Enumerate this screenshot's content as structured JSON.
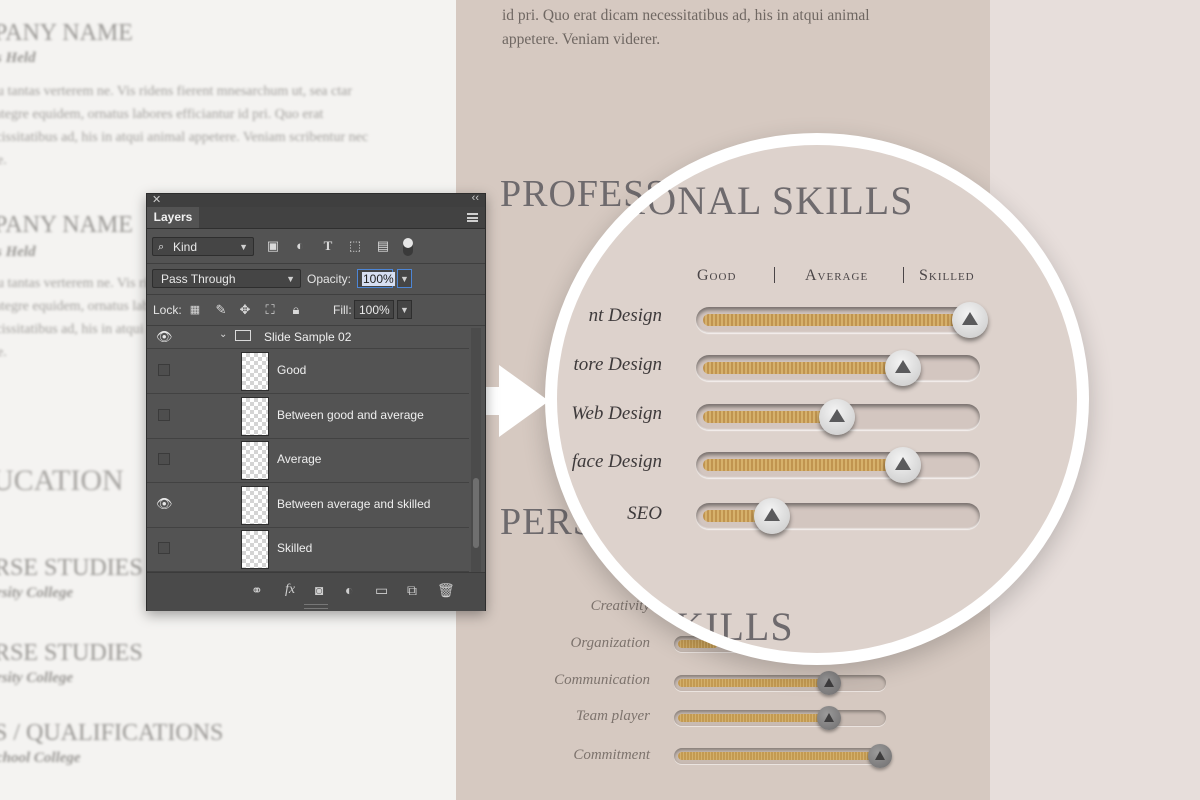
{
  "resume_left": {
    "jobs": [
      {
        "title": "PANY NAME",
        "subtitle": "s Held",
        "text": "bu tantas verterem ne. Vis ridens fierent mnesarchum ut, sea ctar integre equidem, ornatus labores efficiantur id pri. Quo erat scissitatibus ad, his in atqui animal appetere. Veniam scribentur nec ne."
      },
      {
        "title": "PANY NAME",
        "subtitle": "s Held",
        "text": "bu tantas verterem ne. Vis ridens fierent mnesarchum ut, sea ctar integre equidem, ornatus labores efficiantur id pri. Quo erat scissitatibus ad, his in atqui animal appetere. Veniam scribentur nec ne."
      }
    ],
    "education_title": "UCATION",
    "courses": [
      {
        "title": "RSE STUDIES",
        "subtitle": "rsity College"
      },
      {
        "title": "RSE STUDIES",
        "subtitle": "rsity College"
      },
      {
        "title": "S / QUALIFICATIONS",
        "subtitle": "chool College"
      }
    ]
  },
  "resume_right": {
    "intro": "id pri. Quo erat dicam necessitatibus ad, his in atqui animal appetere. Veniam viderer.",
    "professional_title": "PROFESSIONAL SKILLS",
    "personal_title": "PERSONAL SKILLS",
    "skills_word": "SKILLS",
    "personal_skills": [
      {
        "label": "Creativity",
        "level": 0.0
      },
      {
        "label": "Organization",
        "level": 0.0
      },
      {
        "label": "Communication",
        "level": 0.75
      },
      {
        "label": "Team player",
        "level": 0.75
      },
      {
        "label": "Commitment",
        "level": 1.0
      }
    ]
  },
  "magnifier": {
    "headers": [
      "Good",
      "Average",
      "Skilled"
    ],
    "skills": [
      {
        "label": "nt Design",
        "level": 1.0
      },
      {
        "label": "tore Design",
        "level": 0.75
      },
      {
        "label": "Web Design",
        "level": 0.5
      },
      {
        "label": "face Design",
        "level": 0.75
      },
      {
        "label": "SEO",
        "level": 0.25
      }
    ],
    "knob_color": "#d9d9d9",
    "fill_color": "#c9a060"
  },
  "arrow": {
    "icon": "right-arrow-icon",
    "color": "#ffffff"
  },
  "layers_panel": {
    "close": "✕",
    "collapse": "‹‹",
    "tab": "Layers",
    "filter_kind": "Kind",
    "blend_mode": "Pass Through",
    "opacity_label": "Opacity:",
    "opacity_value": "100%",
    "lock_label": "Lock:",
    "fill_label": "Fill:",
    "fill_value": "100%",
    "group_name": "Slide Sample 02",
    "layers": [
      {
        "name": "Good",
        "visible": false
      },
      {
        "name": "Between good and average",
        "visible": false
      },
      {
        "name": "Average",
        "visible": false
      },
      {
        "name": "Between average and skilled",
        "visible": true
      },
      {
        "name": "Skilled",
        "visible": false
      }
    ],
    "bottom_icons": [
      "link-icon",
      "fx-icon",
      "mask-icon",
      "adjustment-icon",
      "folder-icon",
      "new-layer-icon",
      "trash-icon"
    ]
  }
}
